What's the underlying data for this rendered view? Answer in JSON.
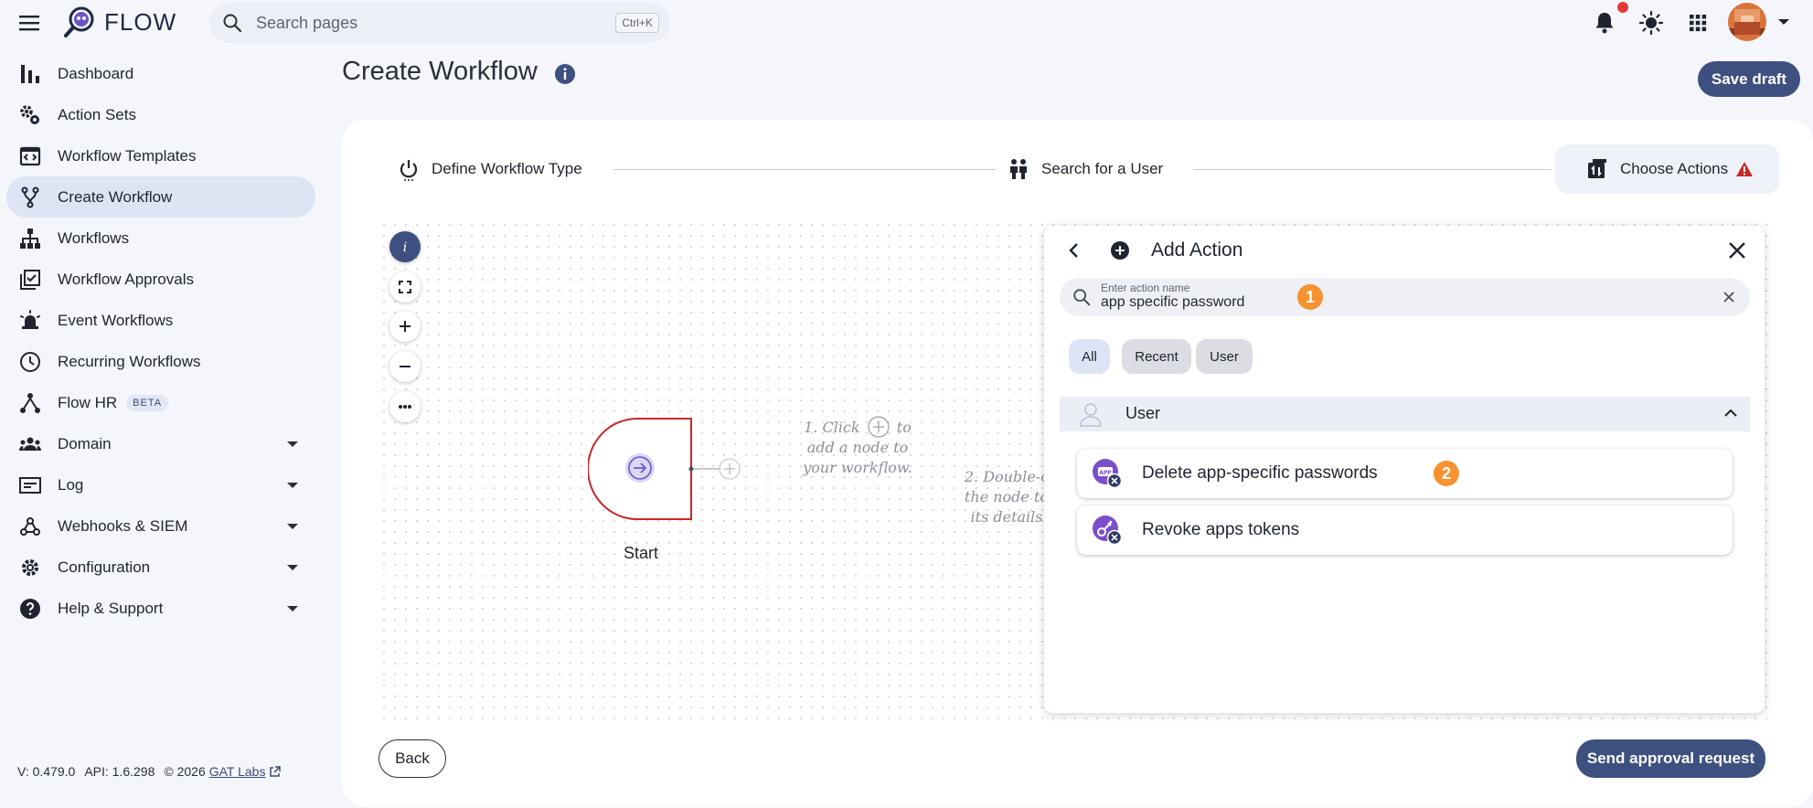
{
  "app": {
    "name": "FLOW"
  },
  "search": {
    "placeholder": "Search pages",
    "shortcut": "Ctrl+K"
  },
  "sidebar": {
    "items": [
      {
        "label": "Dashboard",
        "icon": "bar-chart-icon"
      },
      {
        "label": "Action Sets",
        "icon": "gears-icon"
      },
      {
        "label": "Workflow Templates",
        "icon": "template-icon"
      },
      {
        "label": "Create Workflow",
        "icon": "fork-icon",
        "active": true
      },
      {
        "label": "Workflows",
        "icon": "sitemap-icon"
      },
      {
        "label": "Workflow Approvals",
        "icon": "approval-icon"
      },
      {
        "label": "Event Workflows",
        "icon": "siren-icon"
      },
      {
        "label": "Recurring Workflows",
        "icon": "clock-icon"
      },
      {
        "label": "Flow HR",
        "icon": "hr-icon",
        "badge": "BETA"
      },
      {
        "label": "Domain",
        "icon": "people-icon"
      },
      {
        "label": "Log",
        "icon": "log-icon"
      },
      {
        "label": "Webhooks & SIEM",
        "icon": "webhook-icon"
      },
      {
        "label": "Configuration",
        "icon": "gear-icon"
      },
      {
        "label": "Help & Support",
        "icon": "help-icon"
      }
    ],
    "footer": {
      "version": "V: 0.479.0",
      "api": "API: 1.6.298",
      "copyright": "© 2026",
      "link": "GAT Labs"
    }
  },
  "page": {
    "title": "Create Workflow",
    "save_label": "Save draft"
  },
  "steps": [
    {
      "label": "Define Workflow Type",
      "icon": "power-icon"
    },
    {
      "label": "Search for a User",
      "icon": "users-icon"
    },
    {
      "label": "Choose Actions",
      "icon": "actions-icon"
    }
  ],
  "canvas": {
    "start_label": "Start",
    "hint1": [
      "1. Click",
      "to",
      "add a node to",
      "your workflow."
    ],
    "hint2": [
      "2. Double-c",
      "the node to",
      "its details"
    ]
  },
  "panel": {
    "title": "Add Action",
    "search_label": "Enter action name",
    "search_value": "app specific password",
    "chips": [
      "All",
      "Recent",
      "User"
    ],
    "category": "User",
    "actions": [
      "Delete app-specific passwords",
      "Revoke apps tokens"
    ],
    "markers": [
      "1",
      "2"
    ]
  },
  "buttons": {
    "back": "Back",
    "send": "Send approval request"
  },
  "colors": {
    "primary": "#3e5080",
    "accent": "#f6922f",
    "start_node": "#c62828",
    "action_icon": "#7b4fc9"
  }
}
